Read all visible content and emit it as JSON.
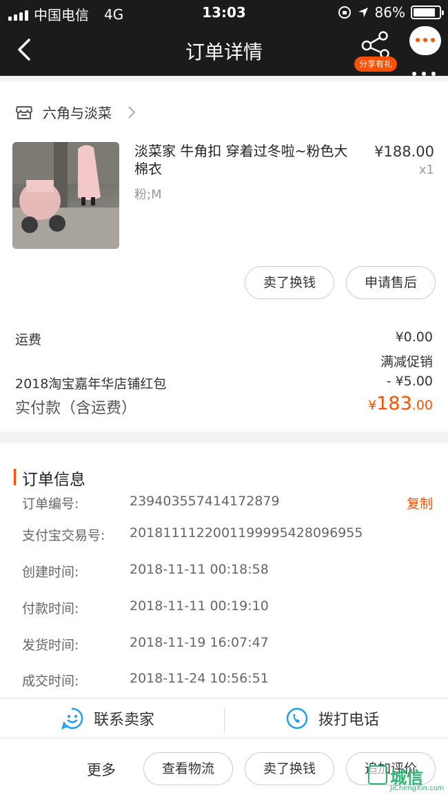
{
  "status_bar": {
    "carrier": "中国电信",
    "network": "4G",
    "time": "13:03",
    "battery": "86%",
    "battery_level": 0.86
  },
  "nav": {
    "title": "订单详情",
    "share_badge": "分享有礼"
  },
  "order": {
    "shop_name": "六角与淡菜",
    "product": {
      "title": "淡菜家  牛角扣 穿着过冬啦~粉色大棉衣",
      "sku": "粉;M",
      "price": "¥188.00",
      "quantity": "x1"
    },
    "item_buttons": [
      "卖了换钱",
      "申请售后"
    ],
    "fees": {
      "shipping_label": "运费",
      "shipping_value": "¥0.00",
      "promo_label": "满减促销",
      "coupon_label": "2018淘宝嘉年华店铺红包",
      "coupon_value": "- ¥5.00",
      "total_label": "实付款（含运费）",
      "total_currency": "¥",
      "total_integer": "183",
      "total_decimal": ".00"
    }
  },
  "order_info": {
    "section_title": "订单信息",
    "copy_label": "复制",
    "rows": [
      {
        "label": "订单编号:",
        "value": "239403557414172879"
      },
      {
        "label": "支付宝交易号:",
        "value": "2018111122001199995428096955"
      },
      {
        "label": "创建时间:",
        "value": "2018-11-11 00:18:58"
      },
      {
        "label": "付款时间:",
        "value": "2018-11-11 00:19:10"
      },
      {
        "label": "发货时间:",
        "value": "2018-11-19 16:07:47"
      },
      {
        "label": "成交时间:",
        "value": "2018-11-24 10:56:51"
      }
    ]
  },
  "contact": {
    "seller_label": "联系卖家",
    "phone_label": "拨打电话"
  },
  "actions": {
    "more_label": "更多",
    "buttons": [
      "查看物流",
      "卖了换钱",
      "追加评价"
    ]
  },
  "watermark": {
    "text": "城信",
    "sub": "JiChengXin.com"
  },
  "colors": {
    "accent": "#ff5000",
    "header_bg": "#1b1b1b",
    "icon_blue": "#1a9ff5"
  }
}
